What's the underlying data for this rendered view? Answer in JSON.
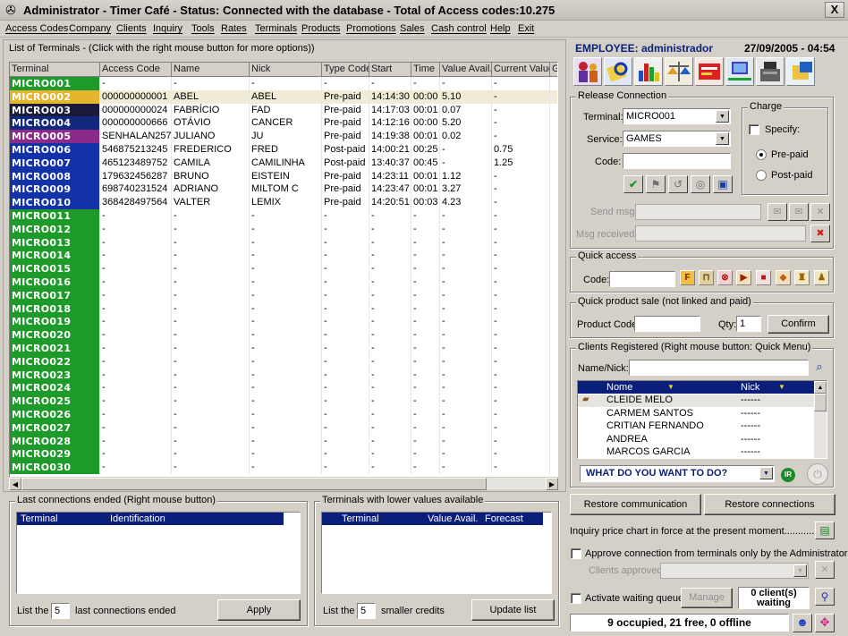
{
  "window": {
    "title": "Administrator - Timer Café - Status: Connected with the database - Total of Access codes:10.275",
    "close_label": "X"
  },
  "menu": [
    "Access Codes",
    "Company",
    "Clients",
    "Inquiry",
    "Tools",
    "Rates",
    "Terminals",
    "Products",
    "Promotions",
    "Sales",
    "Cash control",
    "Help",
    "Exit"
  ],
  "terminals_panel": {
    "title": "List of Terminals - (Click with the right mouse button for more options))",
    "columns": [
      "Terminal",
      "Access Code",
      "Name",
      "Nick",
      "Type Code",
      "Start",
      "Time",
      "Value Avail.",
      "Current Value",
      "G"
    ],
    "rows": [
      {
        "terminal": "MICRO001",
        "code": "-",
        "name": "-",
        "nick": "-",
        "type": "-",
        "start": "-",
        "time": "-",
        "value": "-",
        "current": "-",
        "color": "#1e9a2a"
      },
      {
        "terminal": "MICRO002",
        "code": "000000000001",
        "name": "ABEL",
        "nick": "ABEL",
        "type": "Pre-paid",
        "start": "14:14:30",
        "time": "00:00",
        "value": "5.10",
        "current": "-",
        "color": "#e6b52e"
      },
      {
        "terminal": "MICRO003",
        "code": "000000000024",
        "name": "FABRÍCIO",
        "nick": "FAD",
        "type": "Pre-paid",
        "start": "14:17:03",
        "time": "00:01",
        "value": "0.07",
        "current": "-",
        "color": "#1a1a3a"
      },
      {
        "terminal": "MICRO004",
        "code": "000000000666",
        "name": "OTÁVIO",
        "nick": "CANCER",
        "type": "Pre-paid",
        "start": "14:12:16",
        "time": "00:00",
        "value": "5.20",
        "current": "-",
        "color": "#12287e"
      },
      {
        "terminal": "MICRO005",
        "code": "SENHALAN257",
        "name": "JULIANO",
        "nick": "JU",
        "type": "Pre-paid",
        "start": "14:19:38",
        "time": "00:01",
        "value": "0.02",
        "current": "-",
        "color": "#8a2a8a"
      },
      {
        "terminal": "MICRO006",
        "code": "546875213245",
        "name": "FREDERICO",
        "nick": "FRED",
        "type": "Post-paid",
        "start": "14:00:21",
        "time": "00:25",
        "value": "-",
        "current": "0.75",
        "color": "#1432a8"
      },
      {
        "terminal": "MICRO007",
        "code": "465123489752",
        "name": "CAMILA",
        "nick": "CAMILINHA",
        "type": "Post-paid",
        "start": "13:40:37",
        "time": "00:45",
        "value": "-",
        "current": "1.25",
        "color": "#1432a8"
      },
      {
        "terminal": "MICRO008",
        "code": "179632456287",
        "name": "BRUNO",
        "nick": "EISTEIN",
        "type": "Pre-paid",
        "start": "14:23:11",
        "time": "00:01",
        "value": "1.12",
        "current": "-",
        "color": "#1432a8"
      },
      {
        "terminal": "MICRO009",
        "code": "698740231524",
        "name": "ADRIANO",
        "nick": "MILTOM C",
        "type": "Pre-paid",
        "start": "14:23:47",
        "time": "00:01",
        "value": "3.27",
        "current": "-",
        "color": "#1432a8"
      },
      {
        "terminal": "MICRO010",
        "code": "368428497564",
        "name": "VALTER",
        "nick": "LEMIX",
        "type": "Pre-paid",
        "start": "14:20:51",
        "time": "00:03",
        "value": "4.23",
        "current": "-",
        "color": "#1432a8"
      },
      {
        "terminal": "MICRO011",
        "code": "-",
        "name": "-",
        "nick": "-",
        "type": "-",
        "start": "-",
        "time": "-",
        "value": "-",
        "current": "-",
        "color": "#1e9a2a"
      },
      {
        "terminal": "MICRO012",
        "code": "-",
        "name": "-",
        "nick": "-",
        "type": "-",
        "start": "-",
        "time": "-",
        "value": "-",
        "current": "-",
        "color": "#1e9a2a"
      },
      {
        "terminal": "MICRO013",
        "code": "-",
        "name": "-",
        "nick": "-",
        "type": "-",
        "start": "-",
        "time": "-",
        "value": "-",
        "current": "-",
        "color": "#1e9a2a"
      },
      {
        "terminal": "MICRO014",
        "code": "-",
        "name": "-",
        "nick": "-",
        "type": "-",
        "start": "-",
        "time": "-",
        "value": "-",
        "current": "-",
        "color": "#1e9a2a"
      },
      {
        "terminal": "MICRO015",
        "code": "-",
        "name": "-",
        "nick": "-",
        "type": "-",
        "start": "-",
        "time": "-",
        "value": "-",
        "current": "-",
        "color": "#1e9a2a"
      },
      {
        "terminal": "MICRO016",
        "code": "-",
        "name": "-",
        "nick": "-",
        "type": "-",
        "start": "-",
        "time": "-",
        "value": "-",
        "current": "-",
        "color": "#1e9a2a"
      },
      {
        "terminal": "MICRO017",
        "code": "-",
        "name": "-",
        "nick": "-",
        "type": "-",
        "start": "-",
        "time": "-",
        "value": "-",
        "current": "-",
        "color": "#1e9a2a"
      },
      {
        "terminal": "MICRO018",
        "code": "-",
        "name": "-",
        "nick": "-",
        "type": "-",
        "start": "-",
        "time": "-",
        "value": "-",
        "current": "-",
        "color": "#1e9a2a"
      },
      {
        "terminal": "MICRO019",
        "code": "-",
        "name": "-",
        "nick": "-",
        "type": "-",
        "start": "-",
        "time": "-",
        "value": "-",
        "current": "-",
        "color": "#1e9a2a"
      },
      {
        "terminal": "MICRO020",
        "code": "-",
        "name": "-",
        "nick": "-",
        "type": "-",
        "start": "-",
        "time": "-",
        "value": "-",
        "current": "-",
        "color": "#1e9a2a"
      },
      {
        "terminal": "MICRO021",
        "code": "-",
        "name": "-",
        "nick": "-",
        "type": "-",
        "start": "-",
        "time": "-",
        "value": "-",
        "current": "-",
        "color": "#1e9a2a"
      },
      {
        "terminal": "MICRO022",
        "code": "-",
        "name": "-",
        "nick": "-",
        "type": "-",
        "start": "-",
        "time": "-",
        "value": "-",
        "current": "-",
        "color": "#1e9a2a"
      },
      {
        "terminal": "MICRO023",
        "code": "-",
        "name": "-",
        "nick": "-",
        "type": "-",
        "start": "-",
        "time": "-",
        "value": "-",
        "current": "-",
        "color": "#1e9a2a"
      },
      {
        "terminal": "MICRO024",
        "code": "-",
        "name": "-",
        "nick": "-",
        "type": "-",
        "start": "-",
        "time": "-",
        "value": "-",
        "current": "-",
        "color": "#1e9a2a"
      },
      {
        "terminal": "MICRO025",
        "code": "-",
        "name": "-",
        "nick": "-",
        "type": "-",
        "start": "-",
        "time": "-",
        "value": "-",
        "current": "-",
        "color": "#1e9a2a"
      },
      {
        "terminal": "MICRO026",
        "code": "-",
        "name": "-",
        "nick": "-",
        "type": "-",
        "start": "-",
        "time": "-",
        "value": "-",
        "current": "-",
        "color": "#1e9a2a"
      },
      {
        "terminal": "MICRO027",
        "code": "-",
        "name": "-",
        "nick": "-",
        "type": "-",
        "start": "-",
        "time": "-",
        "value": "-",
        "current": "-",
        "color": "#1e9a2a"
      },
      {
        "terminal": "MICRO028",
        "code": "-",
        "name": "-",
        "nick": "-",
        "type": "-",
        "start": "-",
        "time": "-",
        "value": "-",
        "current": "-",
        "color": "#1e9a2a"
      },
      {
        "terminal": "MICRO029",
        "code": "-",
        "name": "-",
        "nick": "-",
        "type": "-",
        "start": "-",
        "time": "-",
        "value": "-",
        "current": "-",
        "color": "#1e9a2a"
      },
      {
        "terminal": "MICRO030",
        "code": "-",
        "name": "-",
        "nick": "-",
        "type": "-",
        "start": "-",
        "time": "-",
        "value": "-",
        "current": "-",
        "color": "#1e9a2a"
      }
    ]
  },
  "last_connections": {
    "title": "Last connections ended (Right mouse button)",
    "col_terminal": "Terminal",
    "col_identification": "Identification",
    "list_the": "List the",
    "count": "5",
    "suffix": "last connections ended",
    "apply": "Apply"
  },
  "lower_values": {
    "title": "Terminals with lower values available",
    "col_terminal": "Terminal",
    "col_value": "Value Avail.",
    "col_forecast": "Forecast",
    "list_the": "List the",
    "count": "5",
    "suffix": "smaller credits",
    "update": "Update list"
  },
  "employee": {
    "label": "EMPLOYEE: administrador",
    "datetime": "27/09/2005 - 04:54"
  },
  "release": {
    "title": "Release Connection",
    "terminal_label": "Terminal:",
    "terminal_value": "MICRO001",
    "service_label": "Service:",
    "service_value": "GAMES",
    "code_label": "Code:",
    "code_value": "",
    "charge_title": "Charge",
    "specify": "Specify:",
    "prepaid": "Pre-paid",
    "postpaid": "Post-paid",
    "send_msg": "Send msg:",
    "msg_received": "Msg received:"
  },
  "quick_access": {
    "title": "Quick access",
    "code_label": "Code:"
  },
  "quick_sale": {
    "title": "Quick product sale (not linked and paid)",
    "product_label": "Product Code",
    "qty_label": "Qty:",
    "qty_value": "1",
    "confirm": "Confirm"
  },
  "clients": {
    "title": "Clients Registered (Right mouse button: Quick Menu)",
    "name_label": "Name/Nick:",
    "col_name": "Nome",
    "col_nick": "Nick",
    "rows": [
      {
        "name": "CLEIDE MELO",
        "nick": "------"
      },
      {
        "name": "CARMEM SANTOS",
        "nick": "------"
      },
      {
        "name": "CRITIAN FERNANDO",
        "nick": "------"
      },
      {
        "name": "ANDREA",
        "nick": "------"
      },
      {
        "name": "MARCOS GARCIA",
        "nick": "------"
      }
    ],
    "what_todo": "WHAT DO YOU WANT TO DO?"
  },
  "restore": {
    "communication": "Restore communication",
    "connections": "Restore connections"
  },
  "inquiry_text": "Inquiry price chart in force at the present moment..............",
  "approve": {
    "label": "Approve connection from terminals only by the Administrator",
    "clients_approved": "Clients approved:"
  },
  "waiting": {
    "label": "Activate waiting queue",
    "manage": "Manage",
    "count": "0 client(s)",
    "status": "waiting"
  },
  "status_bar": "9 occupied, 21 free, 0 offline",
  "colors": {
    "header_blue": "#0a1e7a",
    "accent_blue": "#12287e",
    "window_gray": "#d4d0c8"
  }
}
